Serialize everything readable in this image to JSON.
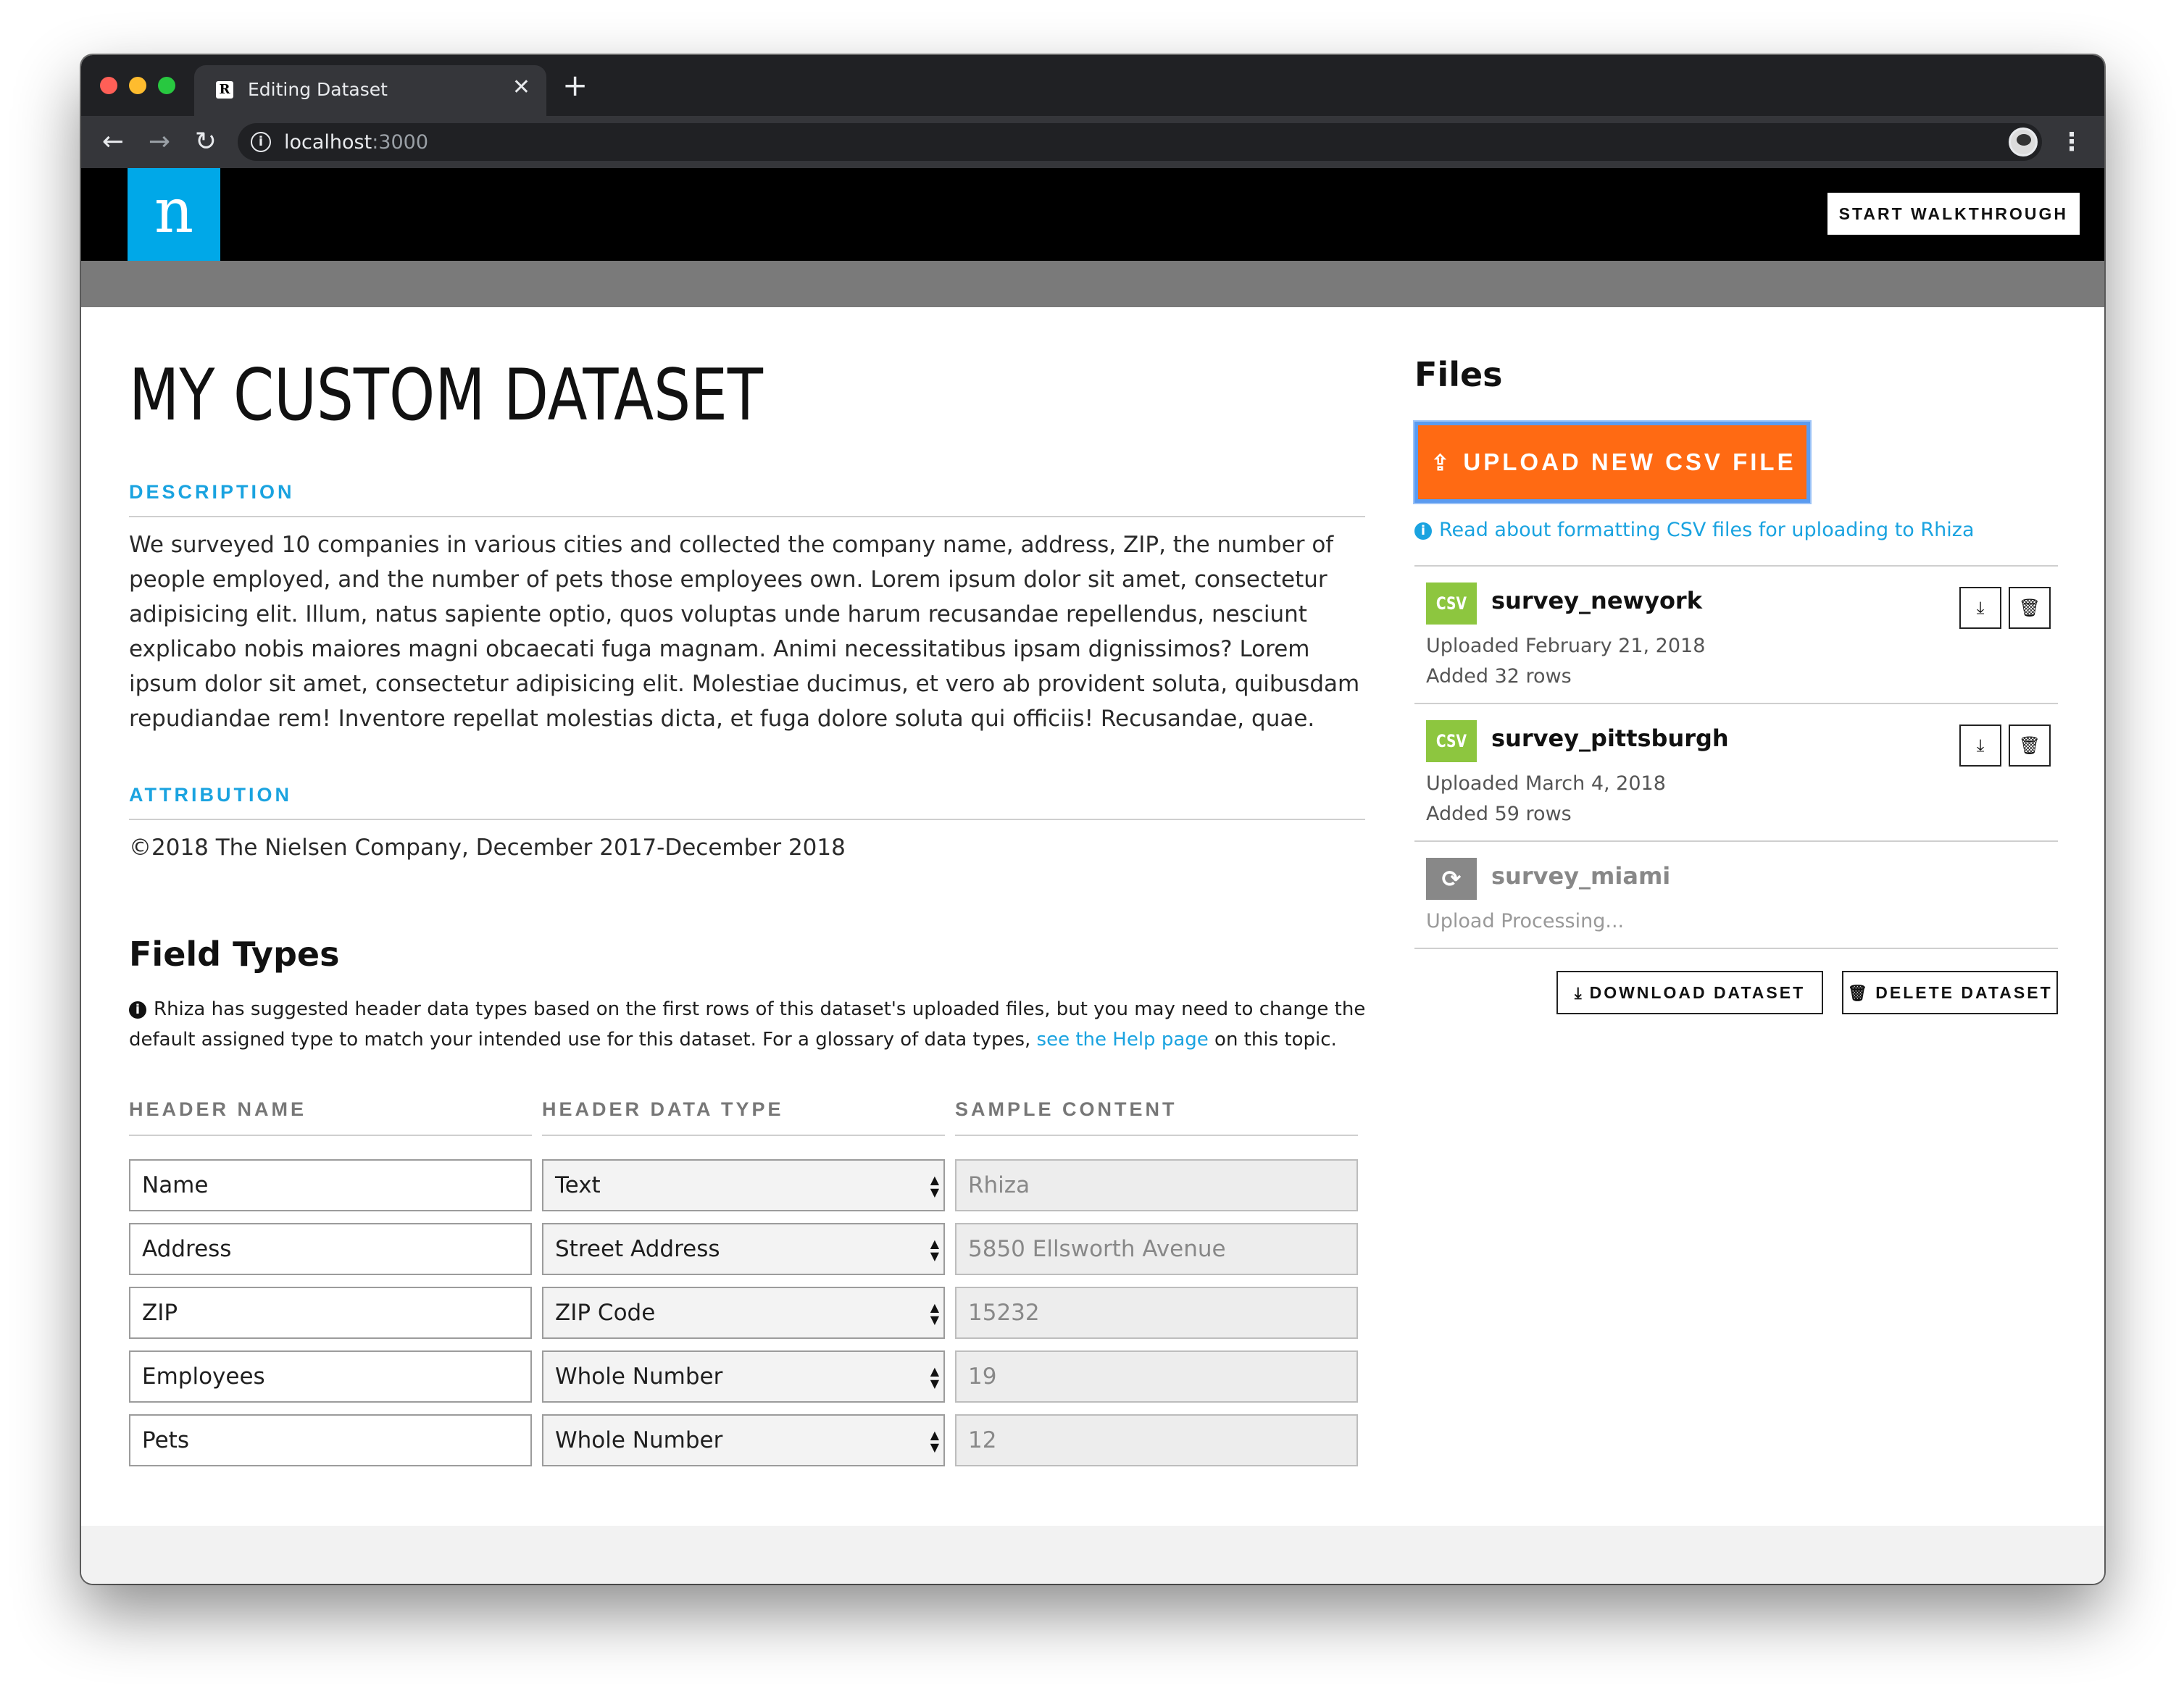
{
  "browser": {
    "tab_title": "Editing Dataset",
    "tab_favicon": "R",
    "url_host": "localhost",
    "url_port": ":3000"
  },
  "header": {
    "logo_letter": "n",
    "walkthrough_label": "START WALKTHROUGH"
  },
  "dataset": {
    "title": "MY CUSTOM DATASET",
    "description_label": "DESCRIPTION",
    "description": "We surveyed 10 companies in various cities and collected the company name, address, ZIP, the number of people employed, and the number of pets those employees own. Lorem ipsum dolor sit amet, consectetur adipisicing elit. Illum, natus sapiente optio, quos voluptas unde harum recusandae repellendus, nesciunt explicabo nobis maiores magni obcaecati fuga magnam. Animi necessitatibus ipsam dignissimos? Lorem ipsum dolor sit amet, consectetur adipisicing elit. Molestiae ducimus, et vero ab provident soluta, quibusdam repudiandae rem! Inventore repellat molestias dicta, et fuga dolore soluta qui officiis! Recusandae, quae.",
    "attribution_label": "ATTRIBUTION",
    "attribution": "©2018 The Nielsen Company, December 2017-December 2018"
  },
  "field_types": {
    "heading": "Field Types",
    "note_text": "Rhiza has suggested header data types based on the first rows of this dataset's uploaded files, but you may need to change the default assigned type to match your intended use for this dataset. For a glossary of data types, ",
    "note_link": "see the Help page",
    "note_tail": " on this topic.",
    "col_header_name": "HEADER NAME",
    "col_header_type": "HEADER DATA TYPE",
    "col_sample": "SAMPLE CONTENT",
    "rows": [
      {
        "name": "Name",
        "type": "Text",
        "sample": "Rhiza"
      },
      {
        "name": "Address",
        "type": "Street Address",
        "sample": "5850 Ellsworth Avenue"
      },
      {
        "name": "ZIP",
        "type": "ZIP Code",
        "sample": "15232"
      },
      {
        "name": "Employees",
        "type": "Whole Number",
        "sample": "19"
      },
      {
        "name": "Pets",
        "type": "Whole Number",
        "sample": "12"
      }
    ]
  },
  "files": {
    "heading": "Files",
    "upload_label": "UPLOAD NEW CSV FILE",
    "help_link": "Read about formatting CSV files for uploading to Rhiza",
    "items": [
      {
        "badge": "CSV",
        "name": "survey_newyork",
        "uploaded": "Uploaded February 21, 2018",
        "added": "Added 32 rows"
      },
      {
        "badge": "CSV",
        "name": "survey_pittsburgh",
        "uploaded": "Uploaded March 4, 2018",
        "added": "Added 59 rows"
      },
      {
        "badge": "",
        "name": "survey_miami",
        "uploaded": "Upload Processing...",
        "added": ""
      }
    ],
    "download_dataset_label": "DOWNLOAD DATASET",
    "delete_dataset_label": "DELETE DATASET"
  },
  "colors": {
    "accent_blue": "#1aa3e0",
    "upload_orange": "#ff6a13",
    "csv_green": "#8dc63f",
    "logo_blue": "#00a8e8"
  }
}
